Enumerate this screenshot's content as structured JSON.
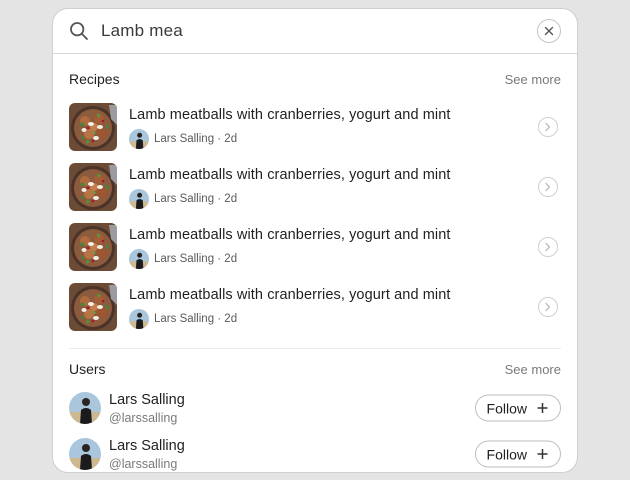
{
  "search": {
    "value": "Lamb mea",
    "search_icon": "search-icon",
    "clear_icon": "close-icon"
  },
  "recipes": {
    "title": "Recipes",
    "see_more": "See more",
    "items": [
      {
        "title": "Lamb meatballs with cranberries, yogurt and mint",
        "author": "Lars Salling",
        "age": "2d",
        "meta": "Lars Salling · 2d"
      },
      {
        "title": "Lamb meatballs with cranberries, yogurt and mint",
        "author": "Lars Salling",
        "age": "2d",
        "meta": "Lars Salling · 2d"
      },
      {
        "title": "Lamb meatballs with cranberries, yogurt and mint",
        "author": "Lars Salling",
        "age": "2d",
        "meta": "Lars Salling · 2d"
      },
      {
        "title": "Lamb meatballs with cranberries, yogurt and mint",
        "author": "Lars Salling",
        "age": "2d",
        "meta": "Lars Salling · 2d"
      }
    ]
  },
  "users": {
    "title": "Users",
    "see_more": "See more",
    "items": [
      {
        "name": "Lars Salling",
        "handle": "@larssalling",
        "follow_label": "Follow"
      },
      {
        "name": "Lars Salling",
        "handle": "@larssalling",
        "follow_label": "Follow"
      }
    ]
  },
  "colors": {
    "background": "#e4e4e4",
    "panel": "#ffffff",
    "text": "#1f1f1f",
    "muted": "#7a7a7a"
  }
}
